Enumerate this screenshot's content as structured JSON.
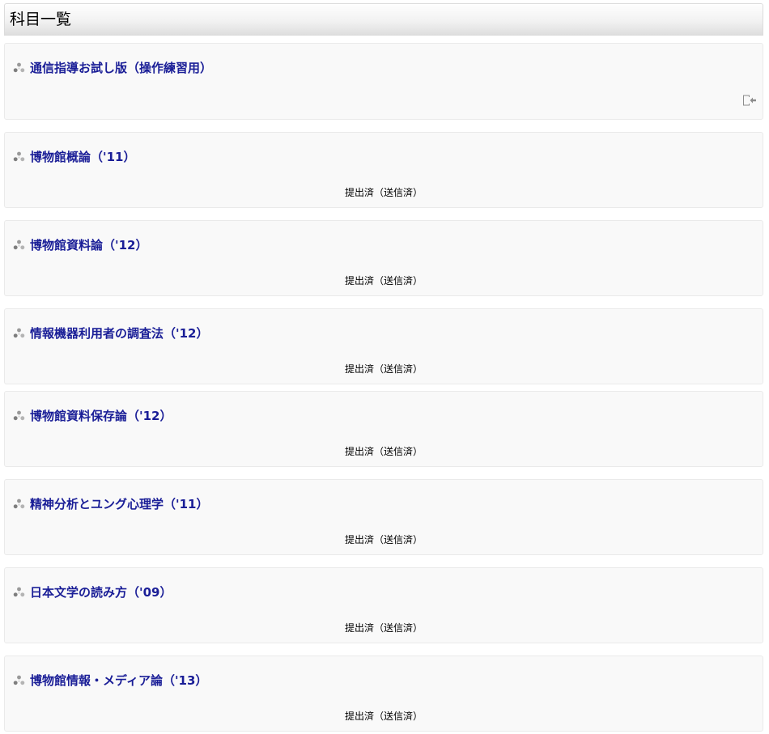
{
  "header": {
    "title": "科目一覧"
  },
  "courses": [
    {
      "name": "通信指導お試し版（操作練習用）",
      "status": "",
      "icon": "course-icon",
      "action_icon": "unenrol-icon"
    },
    {
      "name": "博物館概論（'11）",
      "status": "提出済（送信済）",
      "icon": "course-icon"
    },
    {
      "name": "博物館資料論（'12）",
      "status": "提出済（送信済）",
      "icon": "course-icon"
    },
    {
      "name": "情報機器利用者の調査法（'12）",
      "status": "提出済（送信済）",
      "icon": "course-icon"
    },
    {
      "name": "博物館資料保存論（'12）",
      "status": "提出済（送信済）",
      "icon": "course-icon"
    },
    {
      "name": "精神分析とユング心理学（'11）",
      "status": "提出済（送信済）",
      "icon": "course-icon"
    },
    {
      "name": "日本文学の読み方（'09）",
      "status": "提出済（送信済）",
      "icon": "course-icon"
    },
    {
      "name": "博物館情報・メディア論（'13）",
      "status": "提出済（送信済）",
      "icon": "course-icon"
    }
  ],
  "colors": {
    "link": "#1a1e97",
    "card_background": "#f9f9f9",
    "card_border": "#eaeaea"
  }
}
